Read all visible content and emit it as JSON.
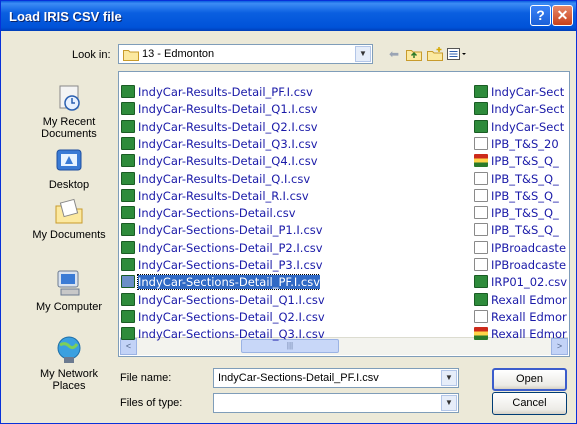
{
  "window": {
    "title": "Load IRIS CSV file",
    "help_label": "?",
    "close_label": "✕"
  },
  "toolbar": {
    "lookin_label": "Look in:",
    "lookin_value": "13 - Edmonton",
    "back_icon": "back-arrow-icon",
    "up_icon": "up-folder-icon",
    "newfolder_icon": "new-folder-icon",
    "views_icon": "views-menu-icon"
  },
  "places": [
    {
      "label": "My Recent Documents",
      "icon": "recent-documents-icon"
    },
    {
      "label": "Desktop",
      "icon": "desktop-icon"
    },
    {
      "label": "My Documents",
      "icon": "my-documents-icon"
    },
    {
      "label": "My Computer",
      "icon": "my-computer-icon"
    },
    {
      "label": "My Network Places",
      "icon": "network-places-icon"
    }
  ],
  "files_col1": [
    {
      "name": "IndyCar-Results-Detail_PF.I.csv",
      "type": "xls"
    },
    {
      "name": "IndyCar-Results-Detail_Q1.I.csv",
      "type": "xls"
    },
    {
      "name": "IndyCar-Results-Detail_Q2.I.csv",
      "type": "xls"
    },
    {
      "name": "IndyCar-Results-Detail_Q3.I.csv",
      "type": "xls"
    },
    {
      "name": "IndyCar-Results-Detail_Q4.I.csv",
      "type": "xls"
    },
    {
      "name": "IndyCar-Results-Detail_Q.I.csv",
      "type": "xls"
    },
    {
      "name": "IndyCar-Results-Detail_R.I.csv",
      "type": "xls"
    },
    {
      "name": "IndyCar-Sections-Detail.csv",
      "type": "xls"
    },
    {
      "name": "IndyCar-Sections-Detail_P1.I.csv",
      "type": "xls"
    },
    {
      "name": "IndyCar-Sections-Detail_P2.I.csv",
      "type": "xls"
    },
    {
      "name": "IndyCar-Sections-Detail_P3.I.csv",
      "type": "xls"
    },
    {
      "name": "IndyCar-Sections-Detail_PF.I.csv",
      "type": "xls",
      "selected": true
    },
    {
      "name": "IndyCar-Sections-Detail_Q1.I.csv",
      "type": "xls"
    },
    {
      "name": "IndyCar-Sections-Detail_Q2.I.csv",
      "type": "xls"
    },
    {
      "name": "IndyCar-Sections-Detail_Q3.I.csv",
      "type": "xls"
    }
  ],
  "files_col2": [
    {
      "name": "IndyCar-Sect",
      "type": "xls"
    },
    {
      "name": "IndyCar-Sect",
      "type": "xls"
    },
    {
      "name": "IndyCar-Sect",
      "type": "xls"
    },
    {
      "name": "IPB_T&S_20",
      "type": "txt"
    },
    {
      "name": "IPB_T&S_Q_",
      "type": "ppt"
    },
    {
      "name": "IPB_T&S_Q_",
      "type": "txt"
    },
    {
      "name": "IPB_T&S_Q_",
      "type": "txt"
    },
    {
      "name": "IPB_T&S_Q_",
      "type": "txt"
    },
    {
      "name": "IPB_T&S_Q_",
      "type": "txt"
    },
    {
      "name": "IPBroadcaste",
      "type": "txt"
    },
    {
      "name": "IPBroadcaste",
      "type": "txt"
    },
    {
      "name": "IRP01_02.csv",
      "type": "xls"
    },
    {
      "name": "Rexall Edmor",
      "type": "xls"
    },
    {
      "name": "Rexall Edmor",
      "type": "txt"
    },
    {
      "name": "Rexall Edmor",
      "type": "ppt"
    }
  ],
  "scrollbar": {
    "left": "<",
    "right": ">",
    "grip": "|||"
  },
  "filename": {
    "label": "File name:",
    "value": "IndyCar-Sections-Detail_PF.I.csv"
  },
  "filetype": {
    "label": "Files of type:",
    "value": ""
  },
  "buttons": {
    "open": "Open",
    "cancel": "Cancel"
  },
  "colors": {
    "title_bar": "#0a5fe0",
    "selection": "#316ac5",
    "file_text": "#1a1aa8",
    "dialog_bg": "#ece9d8"
  }
}
